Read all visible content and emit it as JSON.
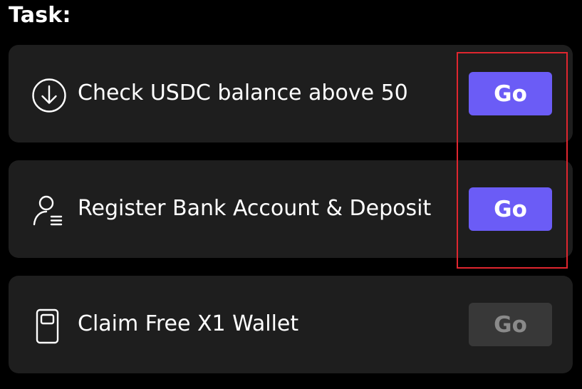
{
  "heading": "Task:",
  "tasks": [
    {
      "icon": "download-circle-icon",
      "label": "Check USDC balance above 50",
      "button_label": "Go",
      "button_state": "active"
    },
    {
      "icon": "user-list-icon",
      "label": "Register Bank Account & Deposit",
      "button_label": "Go",
      "button_state": "active"
    },
    {
      "icon": "wallet-device-icon",
      "label": "Claim Free X1 Wallet",
      "button_label": "Go",
      "button_state": "disabled"
    }
  ],
  "colors": {
    "background": "#000000",
    "card": "#1e1e1e",
    "accent": "#6b5cf6",
    "disabled_button": "#383838",
    "disabled_text": "#8a8a8a",
    "highlight": "#e0262f"
  }
}
